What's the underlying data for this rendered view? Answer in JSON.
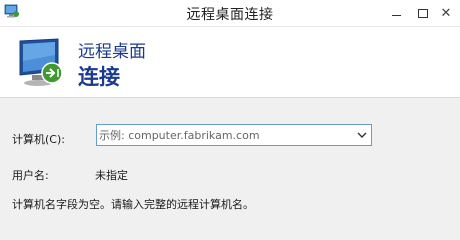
{
  "window": {
    "title": "远程桌面连接",
    "close_glyph": "✕"
  },
  "header": {
    "line1": "远程桌面",
    "line2": "连接"
  },
  "form": {
    "computer_label": "计算机(C):",
    "computer_placeholder": "示例: computer.fabrikam.com",
    "computer_value": "",
    "username_label": "用户名:",
    "username_value": "未指定",
    "hint": "计算机名字段为空。请输入完整的远程计算机名。"
  },
  "icons": [
    "remote-desktop-icon",
    "minimize-icon",
    "maximize-icon",
    "close-icon",
    "dropdown-arrow-icon"
  ],
  "colors": {
    "accent": "#1b3a8f",
    "input_border": "#6a9ac9"
  }
}
